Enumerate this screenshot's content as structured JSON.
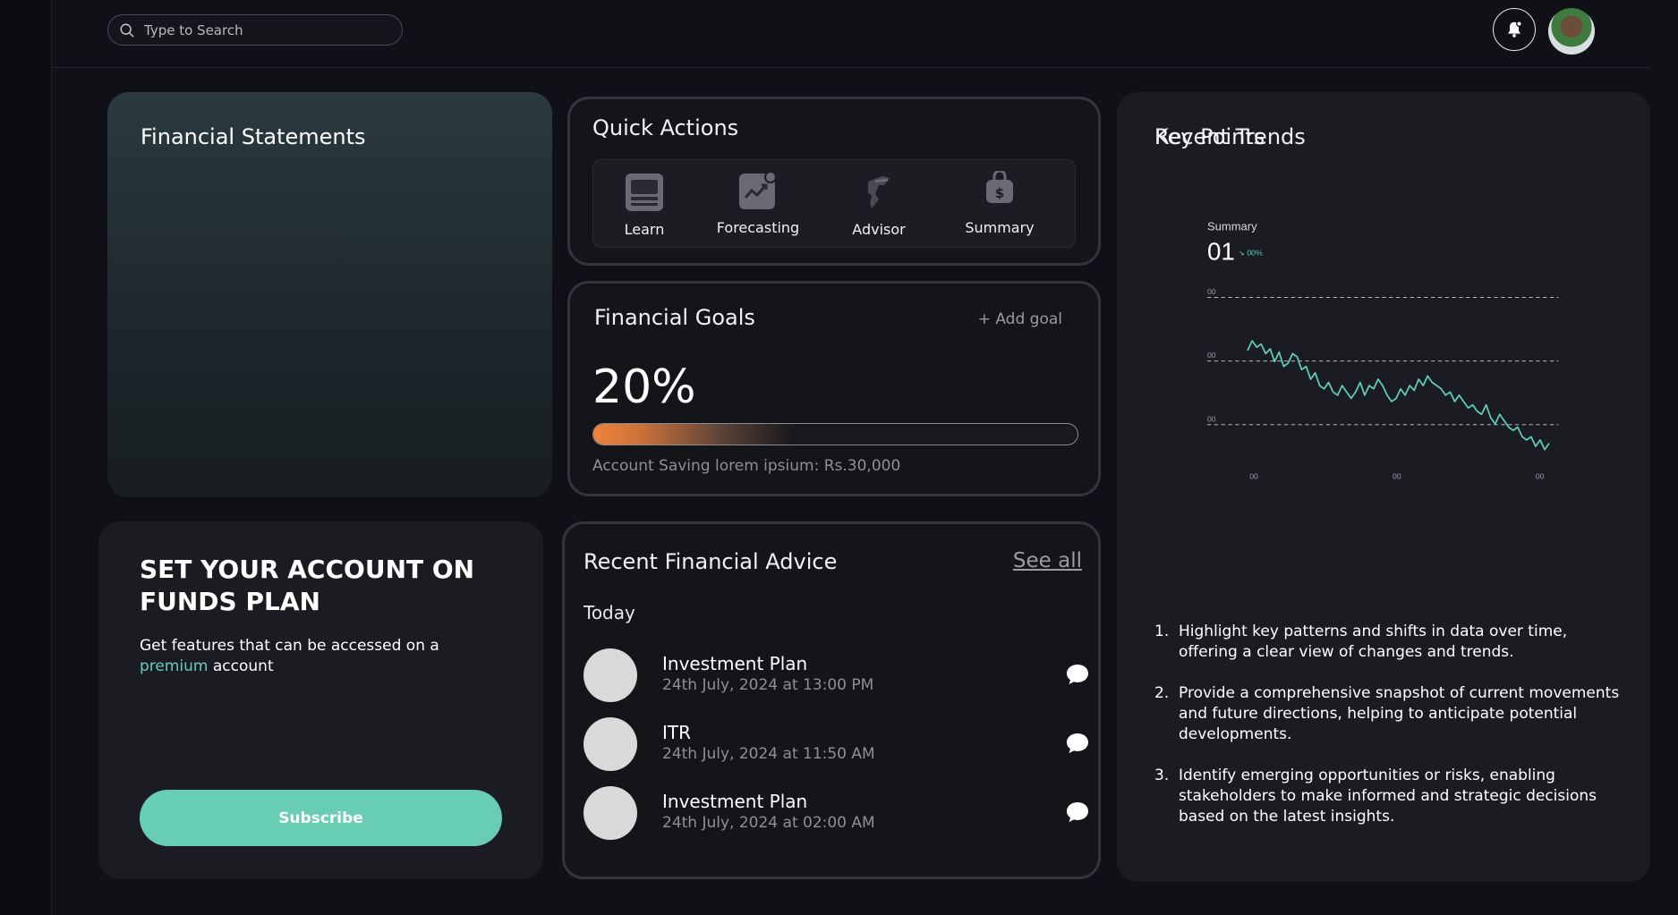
{
  "search": {
    "placeholder": "Type to Search"
  },
  "financial_statements": {
    "title": "Financial Statements"
  },
  "quick_actions": {
    "title": "Quick Actions",
    "items": [
      {
        "label": "Learn",
        "icon": "book-icon"
      },
      {
        "label": "Forecasting",
        "icon": "chart-trend-icon"
      },
      {
        "label": "Advisor",
        "icon": "advisor-icon"
      },
      {
        "label": "Summary",
        "icon": "money-bag-icon"
      }
    ]
  },
  "financial_goals": {
    "title": "Financial Goals",
    "add_label": "+ Add goal",
    "percent": "20%",
    "progress": 0.2,
    "note": "Account Saving lorem ipsium: Rs.30,000"
  },
  "subscribe": {
    "title": "SET YOUR ACCOUNT ON FUNDS PLAN",
    "text_before": "Get features that can be accessed on a ",
    "highlight": "premium",
    "text_after": " account",
    "button": "Subscribe"
  },
  "advice": {
    "title": "Recent Financial Advice",
    "see_all": "See all",
    "group": "Today",
    "items": [
      {
        "title": "Investment Plan",
        "date": "24th July, 2024 at 13:00 PM"
      },
      {
        "title": "ITR",
        "date": "24th July, 2024 at 11:50 AM"
      },
      {
        "title": "Investment Plan",
        "date": "24th July, 2024 at 02:00 AM"
      }
    ]
  },
  "trends": {
    "title": "Recent Trends",
    "key_points_title": "Key Points",
    "key_points": [
      "Highlight key patterns and shifts in data over time, offering a clear view of changes and trends.",
      "Provide a comprehensive snapshot of current movements and future directions, helping to anticipate potential developments.",
      "Identify emerging opportunities or risks, enabling stakeholders to make informed and strategic decisions based on the latest insights."
    ]
  },
  "chart_data": {
    "type": "line",
    "summary_label": "Summary",
    "summary_value": "01",
    "change_label": "00%",
    "y_tick_labels": [
      "00",
      "00",
      "00"
    ],
    "x_tick_labels": [
      "00",
      "00",
      "00"
    ],
    "grid": "dashed horizontal",
    "series_color": "#5fd1b3",
    "values": [
      62,
      68,
      64,
      66,
      60,
      63,
      55,
      61,
      52,
      54,
      60,
      58,
      50,
      52,
      44,
      48,
      40,
      38,
      42,
      36,
      34,
      40,
      36,
      32,
      36,
      42,
      34,
      40,
      38,
      44,
      40,
      34,
      30,
      32,
      38,
      34,
      40,
      37,
      44,
      40,
      46,
      42,
      40,
      38,
      34,
      36,
      30,
      34,
      30,
      26,
      28,
      24,
      22,
      28,
      20,
      16,
      22,
      18,
      14,
      12,
      14,
      8,
      6,
      8,
      2,
      6,
      0,
      4
    ]
  }
}
